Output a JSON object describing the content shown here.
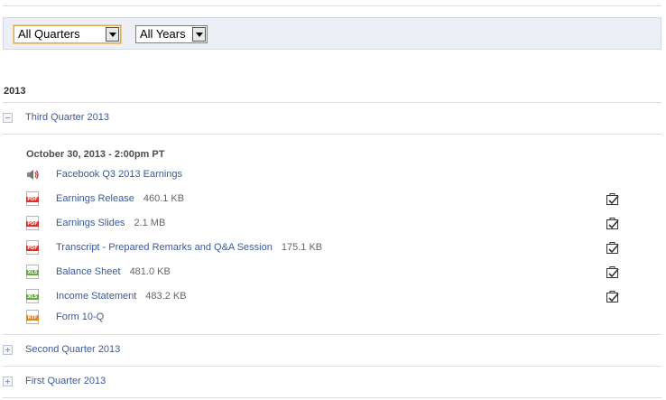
{
  "filters": {
    "quarter": {
      "selected": "All Quarters"
    },
    "year": {
      "selected": "All Years"
    }
  },
  "year_heading": "2013",
  "quarters": [
    {
      "label": "Third Quarter 2013",
      "expanded": true
    },
    {
      "label": "Second Quarter 2013",
      "expanded": false
    },
    {
      "label": "First Quarter 2013",
      "expanded": false
    }
  ],
  "event": {
    "date": "October 30, 2013 - 2:00pm PT",
    "documents": [
      {
        "icon": "speaker-icon",
        "title": "Facebook Q3 2013 Earnings",
        "size": "",
        "has_add": false
      },
      {
        "icon": "pdf-icon",
        "title": "Earnings Release",
        "size": "460.1 KB",
        "has_add": true
      },
      {
        "icon": "pdf-icon",
        "title": "Earnings Slides",
        "size": "2.1 MB",
        "has_add": true
      },
      {
        "icon": "pdf-icon",
        "title": "Transcript - Prepared Remarks and Q&A Session",
        "size": "175.1 KB",
        "has_add": true
      },
      {
        "icon": "xls-icon",
        "title": "Balance Sheet",
        "size": "481.0 KB",
        "has_add": true
      },
      {
        "icon": "xls-icon",
        "title": "Income Statement",
        "size": "483.2 KB",
        "has_add": true
      },
      {
        "icon": "rtf-icon",
        "title": "Form 10-Q",
        "size": "",
        "has_add": false
      }
    ]
  },
  "colors": {
    "link": "#3b5998",
    "filter_bar": "#eceff5",
    "pdf": "#d9302b",
    "xls": "#6aa844",
    "rtf": "#e0861f"
  }
}
